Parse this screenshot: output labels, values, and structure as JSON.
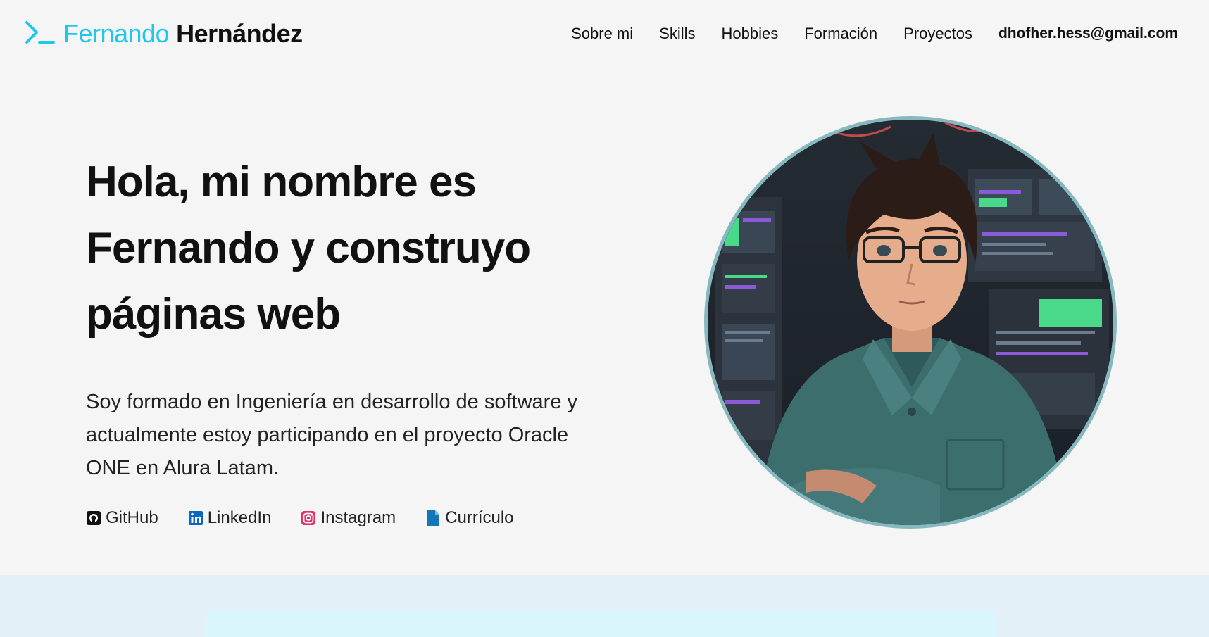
{
  "header": {
    "logo": {
      "first_name": "Fernando",
      "last_name": "Hernández",
      "icon": "terminal-prompt-icon",
      "accent": "#1ec8ec"
    },
    "nav": [
      {
        "label": "Sobre mi"
      },
      {
        "label": "Skills"
      },
      {
        "label": "Hobbies"
      },
      {
        "label": "Formación"
      },
      {
        "label": "Proyectos"
      }
    ],
    "email": "dhofher.hess@gmail.com"
  },
  "hero": {
    "title_lines": [
      "Hola, mi nombre es",
      "Fernando y construyo",
      "páginas web"
    ],
    "description_lines": [
      "Soy formado en Ingeniería en desarrollo de software y",
      "actualmente estoy participando en el proyecto Oracle",
      "ONE en Alura Latam."
    ],
    "social": [
      {
        "label": "GitHub",
        "icon": "github-icon"
      },
      {
        "label": "LinkedIn",
        "icon": "linkedin-icon",
        "color": "#0a66c2"
      },
      {
        "label": "Instagram",
        "icon": "instagram-icon",
        "color": "#e1306c"
      },
      {
        "label": "Currículo",
        "icon": "document-icon",
        "color": "#1277b8"
      }
    ]
  },
  "avatar": {
    "alt": "anime-style-portrait",
    "border_color": "#86b9bf"
  },
  "colors": {
    "background": "#f5f5f5",
    "bottom_band": "#e3f0f7",
    "bottom_card": "#d8f6fb"
  }
}
